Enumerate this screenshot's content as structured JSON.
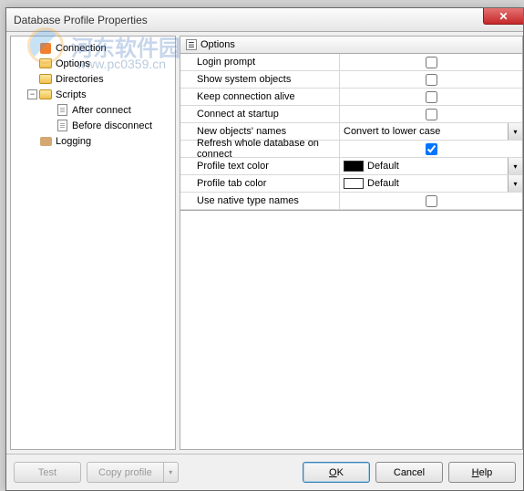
{
  "window": {
    "title": "Database Profile Properties"
  },
  "watermark": {
    "text": "河东软件园",
    "sub": "www.pc0359.cn"
  },
  "tree": {
    "items": [
      {
        "label": "Connection",
        "icon": "conn",
        "level": 1,
        "toggle": ""
      },
      {
        "label": "Options",
        "icon": "folder",
        "level": 1,
        "toggle": ""
      },
      {
        "label": "Directories",
        "icon": "folder",
        "level": 1,
        "toggle": ""
      },
      {
        "label": "Scripts",
        "icon": "folder",
        "level": 1,
        "toggle": "−"
      },
      {
        "label": "After connect",
        "icon": "page",
        "level": 2,
        "toggle": ""
      },
      {
        "label": "Before disconnect",
        "icon": "page",
        "level": 2,
        "toggle": ""
      },
      {
        "label": "Logging",
        "icon": "log",
        "level": 1,
        "toggle": ""
      }
    ]
  },
  "panel": {
    "header_label": "Options"
  },
  "options": {
    "rows": [
      {
        "label": "Login prompt",
        "type": "check",
        "checked": false
      },
      {
        "label": "Show system objects",
        "type": "check",
        "checked": false
      },
      {
        "label": "Keep connection alive",
        "type": "check",
        "checked": false
      },
      {
        "label": "Connect at startup",
        "type": "check",
        "checked": false
      },
      {
        "label": "New objects' names",
        "type": "select",
        "value": "Convert to lower case"
      },
      {
        "label": "Refresh whole database on connect",
        "type": "check",
        "checked": true
      },
      {
        "label": "Profile text color",
        "type": "color",
        "swatch": "black",
        "value": "Default"
      },
      {
        "label": "Profile tab color",
        "type": "color",
        "swatch": "white",
        "value": "Default"
      },
      {
        "label": "Use native type names",
        "type": "check",
        "checked": false
      }
    ]
  },
  "buttons": {
    "test": "Test",
    "copy": "Copy profile",
    "ok": "OK",
    "cancel": "Cancel",
    "help": "Help"
  }
}
